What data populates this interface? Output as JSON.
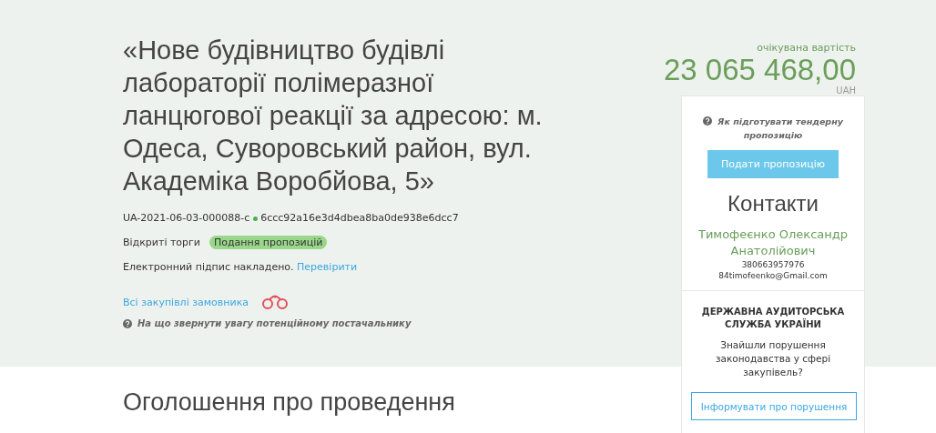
{
  "tender": {
    "title": "«Нове будівництво будівлі лабораторії полімеразної ланцюгової реакції за адресою: м. Одеса, Суворовський район, вул. Академіка Воробйова, 5»",
    "id": "UA-2021-06-03-000088-c",
    "hash": "6ccc92a16e3d4dbea8ba0de938e6dcc7",
    "procedure": "Відкриті торги",
    "status": "Подання пропозицій",
    "signature": "Електронний підпис накладено.",
    "verify_link": "Перевірити",
    "customer_link": "Всі закупівлі замовника",
    "hint": "На що звернути увагу потенційному постачальнику"
  },
  "price": {
    "label": "очікувана вартість",
    "amount": "23 065 468,00",
    "currency": "UAH"
  },
  "sidebar": {
    "hint": "Як підготувати тендерну пропозицію",
    "submit_button": "Подати пропозицію",
    "contacts_title": "Контакти",
    "contact_name": "Тимофеєнко Олександр Анатолійович",
    "phone": "380663957976",
    "email": "84timofeenko@Gmail.com",
    "audit_title": "ДЕРЖАВНА АУДИТОРСЬКА СЛУЖБА УКРАЇНИ",
    "audit_question": "Знайшли порушення законодавства у сфері закупівель?",
    "report_button": "Інформувати про порушення"
  },
  "section_title": "Оголошення про проведення"
}
